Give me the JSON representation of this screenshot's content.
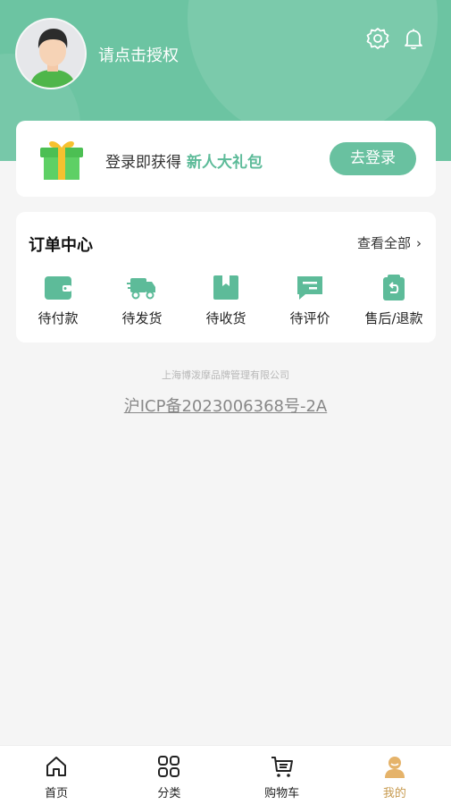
{
  "header": {
    "auth_text": "请点击授权"
  },
  "login_card": {
    "text": "登录即获得",
    "highlight": "新人大礼包",
    "button": "去登录"
  },
  "orders": {
    "title": "订单中心",
    "view_all": "查看全部",
    "items": [
      {
        "label": "待付款",
        "icon": "wallet-icon"
      },
      {
        "label": "待发货",
        "icon": "truck-icon"
      },
      {
        "label": "待收货",
        "icon": "package-icon"
      },
      {
        "label": "待评价",
        "icon": "review-icon"
      },
      {
        "label": "售后/退款",
        "icon": "refund-icon"
      }
    ]
  },
  "footer": {
    "company": "上海博泼摩品牌管理有限公司",
    "icp": "沪ICP备2023006368号-2A"
  },
  "tabbar": {
    "items": [
      {
        "label": "首页",
        "icon": "home-icon"
      },
      {
        "label": "分类",
        "icon": "category-icon"
      },
      {
        "label": "购物车",
        "icon": "cart-icon"
      },
      {
        "label": "我的",
        "icon": "profile-icon",
        "active": true
      }
    ]
  },
  "colors": {
    "primary": "#6cc4a2",
    "highlight": "#5dbb99",
    "active_tab": "#c79a4f"
  }
}
